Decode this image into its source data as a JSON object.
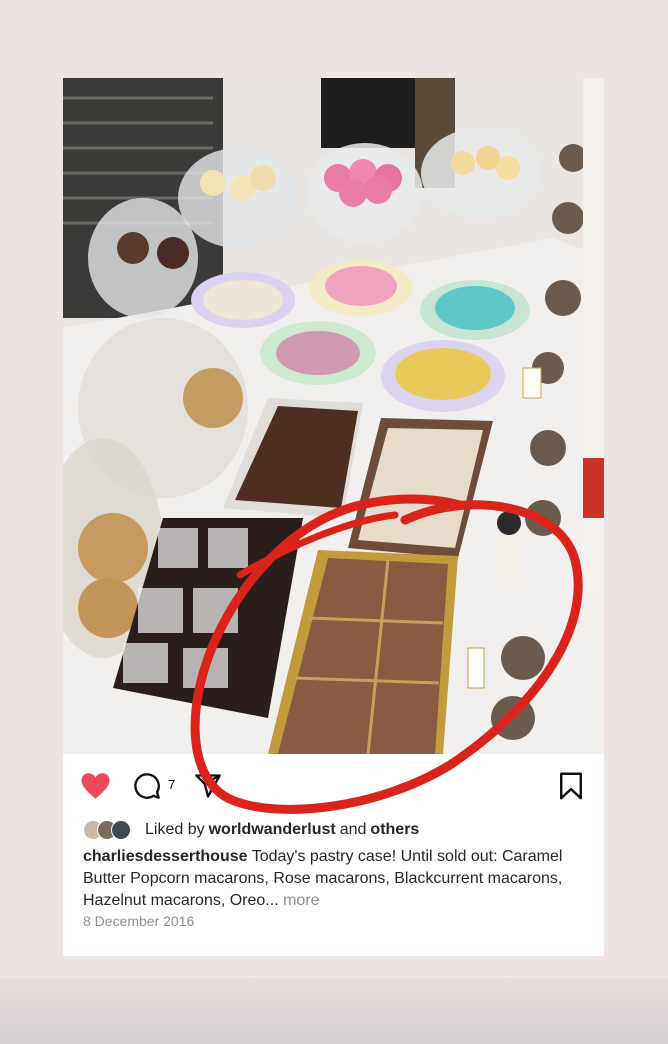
{
  "post": {
    "comment_count": "7",
    "liked_by_prefix": "Liked by",
    "liked_by_user": "worldwanderlust",
    "liked_by_and": "and",
    "liked_by_others": "others",
    "username": "charliesdesserthouse",
    "caption_text": "Today's pastry case! Until sold out: Caramel Butter Popcorn macarons, Rose macarons, Blackcurrent macarons, Hazelnut macarons, Oreo...",
    "more_label": "more",
    "date": "8 December 2016"
  },
  "colors": {
    "like_red": "#ed4956",
    "annotation_red": "#d9231b",
    "background": "#efe4e4"
  },
  "icons": {
    "like": "heart-icon",
    "comment": "comment-icon",
    "share": "share-icon",
    "save": "bookmark-icon"
  }
}
